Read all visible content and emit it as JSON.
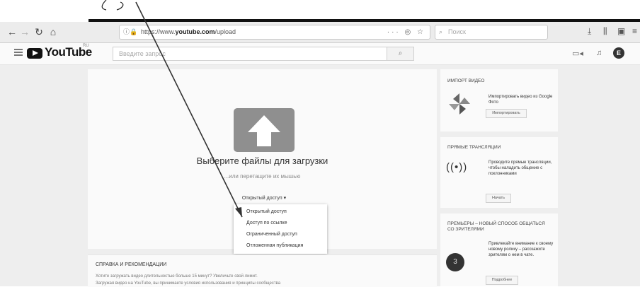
{
  "browser": {
    "url_prefix": "https://www.",
    "url_domain": "youtube.com",
    "url_path": "/upload",
    "url_tools": "··· ◎ ☆",
    "search_placeholder": "Поиск"
  },
  "youtube": {
    "logo_text": "YouTube",
    "logo_region": "RU",
    "search_placeholder": "Введите запрос",
    "avatar_letter": "E"
  },
  "upload": {
    "title": "Выберите файлы для загрузки",
    "subtitle": "...или перетащите их мышью",
    "privacy_selected": "Открытый доступ ▾",
    "privacy_options": [
      "Открытый доступ",
      "Доступ по ссылке",
      "Ограниченный доступ",
      "Отложенная публикация"
    ]
  },
  "help": {
    "title": "СПРАВКА И РЕКОМЕНДАЦИИ",
    "line1": "Хотите загружать видео длительностью больше 15 минут? Увеличьте свой лимит.",
    "line2": "Загружая видео на YouTube, вы принимаете условия использования и принципы сообщества"
  },
  "sidebar": {
    "import": {
      "title": "ИМПОРТ ВИДЕО",
      "text": "Импортировать видео из Google Фото",
      "button": "Импортировать"
    },
    "live": {
      "title": "ПРЯМЫЕ ТРАНСЛЯЦИИ",
      "text": "Проводите прямые трансляции, чтобы наладить общение с поклонниками",
      "button": "Начать"
    },
    "premieres": {
      "title": "ПРЕМЬЕРЫ – НОВЫЙ СПОСОБ ОБЩАТЬСЯ СО ЗРИТЕЛЯМИ",
      "text": "Привлекайте внимание к своему новому ролику – расскажите зрителям о нем в чате.",
      "button": "Подробнее"
    }
  }
}
